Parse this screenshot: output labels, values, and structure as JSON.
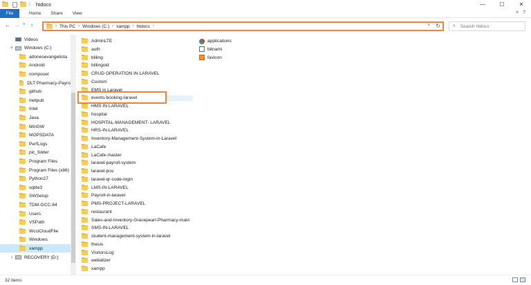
{
  "window": {
    "title": "htdocs",
    "minimize": "—",
    "maximize": "☐",
    "close": "✕"
  },
  "ribbon": {
    "file": "File",
    "home": "Home",
    "share": "Share",
    "view": "View",
    "collapse": "˅",
    "help": "?"
  },
  "nav": {
    "back": "←",
    "forward": "→",
    "recent": "˅",
    "up": "↑"
  },
  "address": {
    "crumbs": [
      "This PC",
      "Windows (C:)",
      "xampp",
      "htdocs"
    ],
    "separator": "›",
    "dropdown": "˅",
    "refresh": "↻"
  },
  "search": {
    "placeholder": "Search htdocs",
    "icon": "search-icon"
  },
  "sidebar": {
    "items": [
      {
        "label": "Videos",
        "type": "special"
      },
      {
        "label": "Windows (C:)",
        "type": "drive"
      },
      {
        "label": "adonesevangelista",
        "type": "folder"
      },
      {
        "label": "Android",
        "type": "folder"
      },
      {
        "label": "composer",
        "type": "folder"
      },
      {
        "label": "DLT Pharmacy-Payro",
        "type": "folder"
      },
      {
        "label": "github",
        "type": "folder"
      },
      {
        "label": "inetpub",
        "type": "folder"
      },
      {
        "label": "Intel",
        "type": "folder"
      },
      {
        "label": "Java",
        "type": "folder"
      },
      {
        "label": "MinGW",
        "type": "folder"
      },
      {
        "label": "MOPSDATA",
        "type": "folder"
      },
      {
        "label": "PerfLogs",
        "type": "folder"
      },
      {
        "label": "pic_folder",
        "type": "folder"
      },
      {
        "label": "Program Files",
        "type": "folder"
      },
      {
        "label": "Program Files (x86)",
        "type": "folder"
      },
      {
        "label": "Python27",
        "type": "folder"
      },
      {
        "label": "sqlite3",
        "type": "folder"
      },
      {
        "label": "SWSetup",
        "type": "folder"
      },
      {
        "label": "TDM-GCC-64",
        "type": "folder"
      },
      {
        "label": "Users",
        "type": "folder"
      },
      {
        "label": "VSPath",
        "type": "folder"
      },
      {
        "label": "WcciCloudFile",
        "type": "folder"
      },
      {
        "label": "Windows",
        "type": "folder"
      },
      {
        "label": "xampp",
        "type": "folder",
        "selected": true
      },
      {
        "label": "RECOVERY (D:)",
        "type": "drive"
      }
    ]
  },
  "files": {
    "folders": [
      "AdminLTE",
      "auth",
      "billing",
      "billingold",
      "CRUD OPERATION IN LARAVEL",
      "Custom",
      "EMS in Laravel",
      "events-booking-laravel",
      "HMS IN LARAVEL",
      "hospital",
      "HOSPITAL-MANAGEMENT- LARAVEL",
      "HRS-IN-LARAVEL",
      "Inventory-Management-System-in-Laravel",
      "LaCafe",
      "LaCafe-master",
      "laravel-payroll-system",
      "laravel-pos",
      "laravel-qr-code-login",
      "LMS-IN-LARAVEL",
      "Payroll-in-laravel",
      "PMS-PROJECT-LARAVEL",
      "restaurant",
      "Sales-and-Inventory-Gracepearl-Pharmacy-main",
      "SMS-IN-LARAVEL",
      "student-management-system-in-laravel",
      "thesis",
      "VisitorsLog",
      "webalizer",
      "xampp"
    ],
    "others": [
      {
        "label": "applications",
        "icon": "chrome-html-icon"
      },
      {
        "label": "bitnami",
        "icon": "css-file-icon"
      },
      {
        "label": "favicon",
        "icon": "favicon-image-icon"
      }
    ],
    "highlighted": "events-booking-laravel"
  },
  "status": {
    "count": "32 items"
  },
  "colors": {
    "accent": "#1f6fc5",
    "highlight_border": "#f0883a",
    "selection": "#cce8ff",
    "folder": "#f6cc5a"
  }
}
